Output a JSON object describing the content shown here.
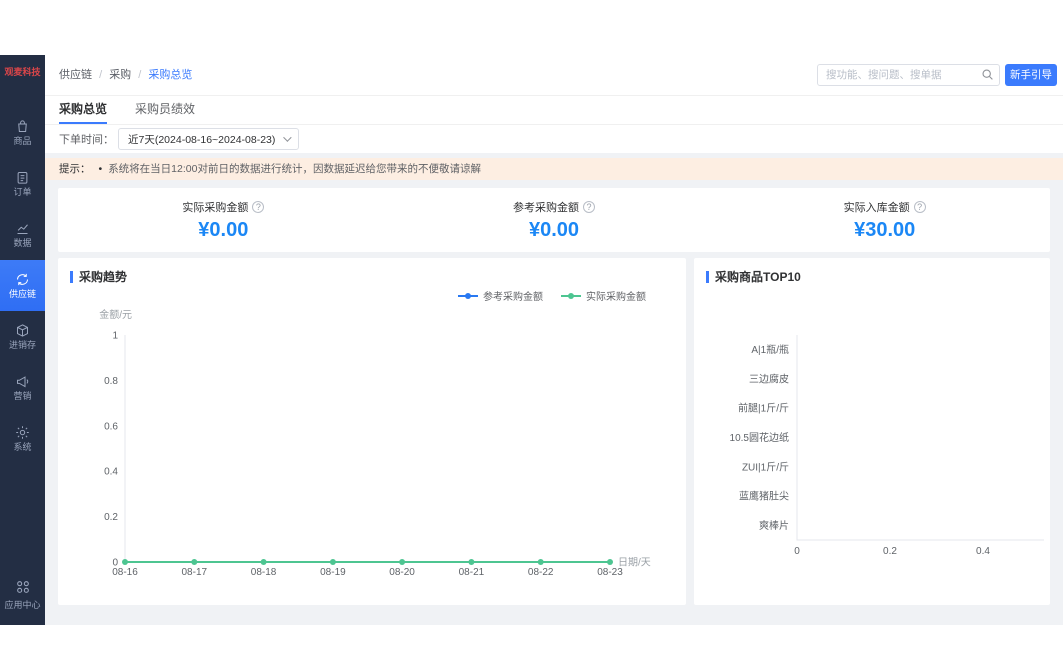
{
  "brand": {
    "logo_text": "观麦科技"
  },
  "sidebar": {
    "items": [
      {
        "label": "商品"
      },
      {
        "label": "订单"
      },
      {
        "label": "数据"
      },
      {
        "label": "供应链",
        "active": true
      },
      {
        "label": "进销存"
      },
      {
        "label": "营销"
      },
      {
        "label": "系统"
      }
    ],
    "app_center_label": "应用中心"
  },
  "header": {
    "breadcrumb": {
      "items": [
        "供应链",
        "采购",
        "采购总览"
      ],
      "separator": "/"
    },
    "search_placeholder": "搜功能、搜问题、搜单据",
    "guide_button_label": "新手引导"
  },
  "tabs": {
    "items": [
      {
        "label": "采购总览",
        "active": true
      },
      {
        "label": "采购员绩效",
        "active": false
      }
    ]
  },
  "filters": {
    "order_time_label": "下单时间：",
    "order_time_value": "近7天(2024-08-16~2024-08-23)"
  },
  "notice": {
    "prefix": "提示：",
    "bullet": "•",
    "text": "系统将在当日12:00对前日的数据进行统计，因数据延迟给您带来的不便敬请谅解"
  },
  "stats": {
    "items": [
      {
        "label": "实际采购金额",
        "value": "¥0.00"
      },
      {
        "label": "参考采购金额",
        "value": "¥0.00"
      },
      {
        "label": "实际入库金额",
        "value": "¥30.00"
      }
    ]
  },
  "colors": {
    "accent_blue": "#3b7bfd",
    "value_blue": "#1b87f5",
    "series_blue": "#2979f2",
    "series_green": "#4dc591",
    "sidebar_bg": "#232e44",
    "sidebar_active_bg": "#2f6ef4",
    "notice_bg": "#fdeee2",
    "content_bg": "#f0f2f5"
  },
  "chart_data": [
    {
      "type": "line",
      "title": "采购趋势",
      "xlabel": "日期/天",
      "ylabel": "金额/元",
      "x": [
        "08-16",
        "08-17",
        "08-18",
        "08-19",
        "08-20",
        "08-21",
        "08-22",
        "08-23"
      ],
      "yticks": [
        0,
        0.2,
        0.4,
        0.6,
        0.8,
        1
      ],
      "ylim": [
        0,
        1
      ],
      "grid": false,
      "legend_position": "top-right",
      "series": [
        {
          "name": "参考采购金额",
          "color": "#2979f2",
          "values": [
            0,
            0,
            0,
            0,
            0,
            0,
            0,
            0
          ]
        },
        {
          "name": "实际采购金额",
          "color": "#4dc591",
          "values": [
            0,
            0,
            0,
            0,
            0,
            0,
            0,
            0
          ]
        }
      ]
    },
    {
      "type": "bar",
      "orientation": "horizontal",
      "title": "采购商品TOP10",
      "categories": [
        "A|1瓶/瓶",
        "三边腐皮",
        "前腿|1斤/斤",
        "10.5圆花边纸",
        "ZUI|1斤/斤",
        "蓝鹰猪肚尖",
        "爽棒片"
      ],
      "values": [
        0,
        0,
        0,
        0,
        0,
        0,
        0
      ],
      "xticks": [
        0,
        0.2,
        0.4
      ],
      "xlim": [
        0,
        0.5
      ]
    }
  ]
}
